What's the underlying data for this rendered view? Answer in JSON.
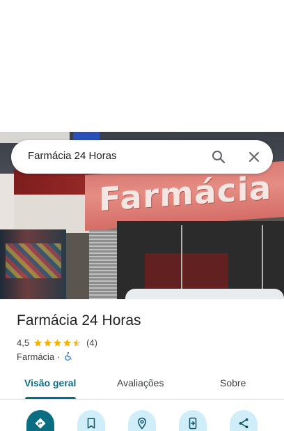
{
  "search": {
    "query": "Farmácia 24 Horas"
  },
  "place": {
    "name": "Farmácia 24 Horas",
    "rating": "4,5",
    "rating_value": 4.5,
    "review_count": "(4)",
    "category": "Farmácia",
    "separator": "·",
    "accessibility_icon": "wheelchair-icon"
  },
  "photo": {
    "sign_text": "Farmácia"
  },
  "tabs": [
    {
      "label": "Visão geral",
      "selected": true
    },
    {
      "label": "Avaliações",
      "selected": false
    },
    {
      "label": "Sobre",
      "selected": false
    }
  ],
  "actions": [
    {
      "icon": "directions-icon"
    },
    {
      "icon": "bookmark-icon"
    },
    {
      "icon": "nearby-icon"
    },
    {
      "icon": "send-to-phone-icon"
    },
    {
      "icon": "share-icon"
    }
  ],
  "colors": {
    "accent": "#0b6d82",
    "action_bg": "#cfeefa",
    "star": "#f4b400",
    "accessibility": "#1a73e8"
  }
}
